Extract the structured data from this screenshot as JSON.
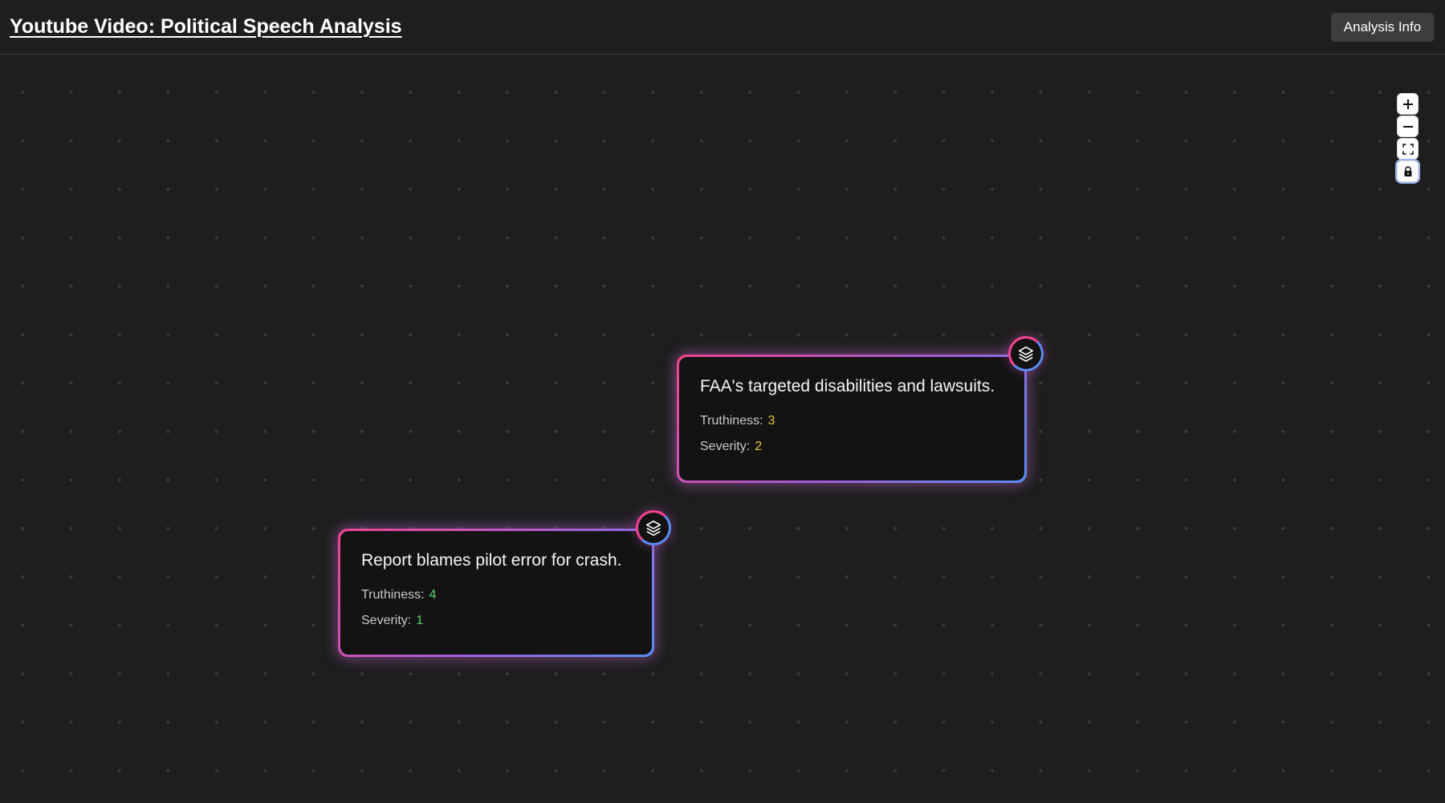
{
  "header": {
    "title": "Youtube Video: Political Speech Analysis",
    "analysis_button": "Analysis Info"
  },
  "controls": [
    {
      "name": "zoom-in",
      "icon": "plus-icon"
    },
    {
      "name": "zoom-out",
      "icon": "minus-icon"
    },
    {
      "name": "fit-view",
      "icon": "fit-view-icon"
    },
    {
      "name": "lock",
      "icon": "lock-icon"
    }
  ],
  "nodes": [
    {
      "title": "FAA's targeted disabilities and lawsuits.",
      "truthiness_label": "Truthiness:",
      "truthiness_value": "3",
      "truthiness_color": "#e8c53a",
      "severity_label": "Severity:",
      "severity_value": "2",
      "severity_color": "#e8c53a",
      "icon": "layers-icon"
    },
    {
      "title": "Report blames pilot error for crash.",
      "truthiness_label": "Truthiness:",
      "truthiness_value": "4",
      "truthiness_color": "#5ed16a",
      "severity_label": "Severity:",
      "severity_value": "1",
      "severity_color": "#5ed16a",
      "icon": "layers-icon"
    }
  ],
  "colors": {
    "background": "#1e1e1e",
    "node_gradient_start": "#f0448e",
    "node_gradient_end": "#5a8cf2"
  }
}
